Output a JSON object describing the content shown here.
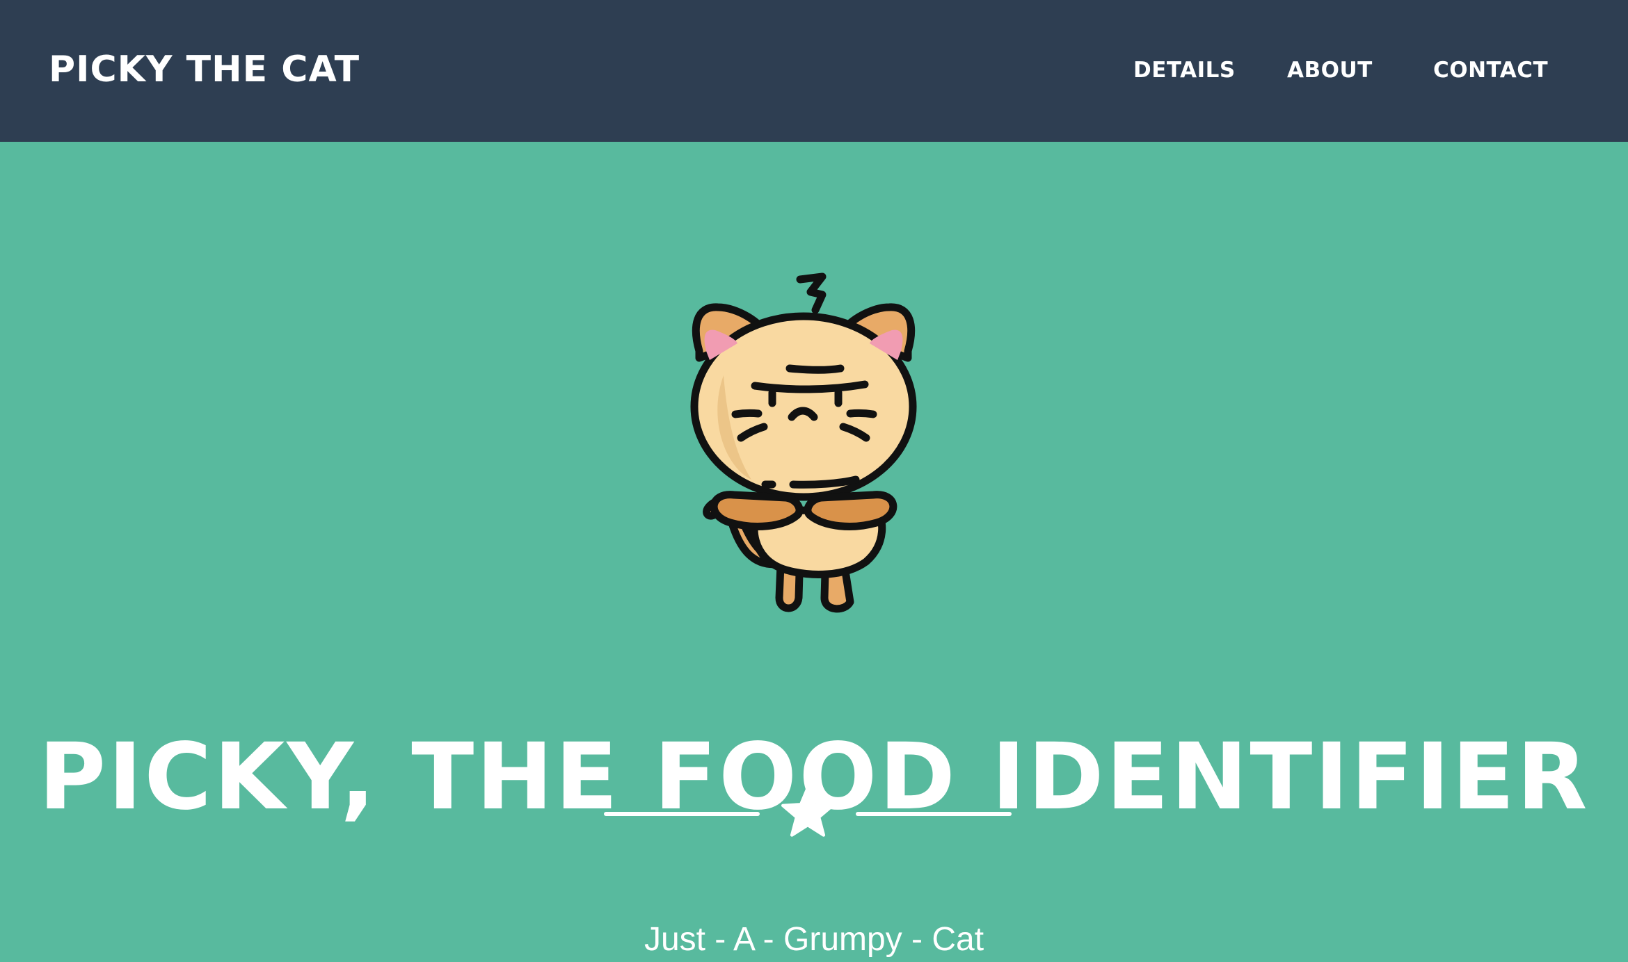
{
  "navbar": {
    "brand": "PICKY THE CAT",
    "links": [
      {
        "label": "DETAILS"
      },
      {
        "label": "ABOUT"
      },
      {
        "label": "CONTACT"
      }
    ],
    "background_color": "#2e3e52"
  },
  "hero": {
    "background_color": "#58ba9e",
    "mascot_icon": "grumpy-cat-icon",
    "title": "PICKY, THE FOOD IDENTIFIER",
    "divider_icon": "star-icon",
    "subtitle": "Just - A - Grumpy - Cat"
  }
}
